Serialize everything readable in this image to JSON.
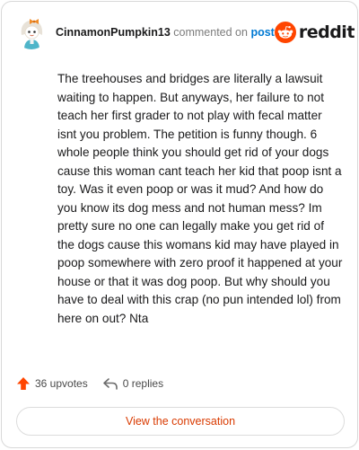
{
  "header": {
    "username": "CinnamonPumpkin13",
    "action_text": "commented on",
    "post_link": "post",
    "brand": "reddit"
  },
  "comment": {
    "body": "The treehouses and bridges are literally a lawsuit waiting to happen. But anyways, her failure to not teach her first grader to not play with fecal matter isnt you problem. The petition is funny though. 6 whole people think you should get rid of your dogs cause this woman cant teach her kid that poop isnt a toy. Was it even poop or was it mud? And how do you know its dog mess and not human mess? Im pretty sure no one can legally make you get rid of the dogs cause this womans kid may have played in poop somewhere with zero proof it happened at your house or that it was dog poop. But why should you have to deal with this crap (no pun intended lol) from here on out? Nta"
  },
  "stats": {
    "upvotes": "36 upvotes",
    "replies": "0 replies"
  },
  "cta": {
    "label": "View the conversation"
  },
  "colors": {
    "brand_orange": "#ff4500",
    "link_blue": "#0079d3",
    "cta_text": "#d93a00",
    "text_primary": "#1a1a1b",
    "text_secondary": "#7c7c7c"
  },
  "icons": {
    "avatar": "user-avatar",
    "brand": "reddit-snoo-icon",
    "upvote": "upvote-arrow-icon",
    "reply": "reply-arrow-icon"
  }
}
